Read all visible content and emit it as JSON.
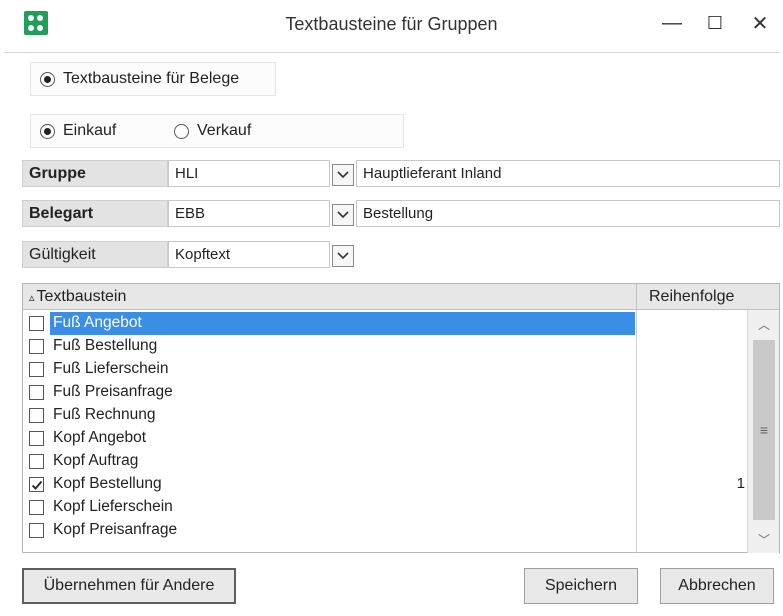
{
  "window": {
    "title": "Textbausteine für Gruppen",
    "controls": {
      "minimize": "—",
      "maximize": "☐",
      "close": "✕"
    }
  },
  "scope": {
    "label": "Textbausteine für Belege",
    "selected": true
  },
  "direction": {
    "einkauf": {
      "label": "Einkauf",
      "selected": true
    },
    "verkauf": {
      "label": "Verkauf",
      "selected": false
    }
  },
  "form": {
    "gruppe": {
      "label": "Gruppe",
      "code": "HLI",
      "description": "Hauptlieferant Inland"
    },
    "belegart": {
      "label": "Belegart",
      "code": "EBB",
      "description": "Bestellung"
    },
    "gueltigkeit": {
      "label": "Gültigkeit",
      "value": "Kopftext"
    }
  },
  "list": {
    "columns": {
      "textbaustein": "Textbaustein",
      "reihenfolge": "Reihenfolge"
    },
    "sort_indicator": "▵",
    "rows": [
      {
        "label": "Fuß Angebot",
        "checked": false,
        "order": "",
        "selected": true
      },
      {
        "label": "Fuß Bestellung",
        "checked": false,
        "order": ""
      },
      {
        "label": "Fuß Lieferschein",
        "checked": false,
        "order": ""
      },
      {
        "label": "Fuß Preisanfrage",
        "checked": false,
        "order": ""
      },
      {
        "label": "Fuß Rechnung",
        "checked": false,
        "order": ""
      },
      {
        "label": "Kopf Angebot",
        "checked": false,
        "order": ""
      },
      {
        "label": "Kopf Auftrag",
        "checked": false,
        "order": ""
      },
      {
        "label": "Kopf Bestellung",
        "checked": true,
        "order": "1"
      },
      {
        "label": "Kopf Lieferschein",
        "checked": false,
        "order": ""
      },
      {
        "label": "Kopf Preisanfrage",
        "checked": false,
        "order": ""
      }
    ]
  },
  "buttons": {
    "uebernehmen": "Übernehmen für Andere",
    "speichern": "Speichern",
    "abbrechen": "Abbrechen"
  },
  "colors": {
    "selection": "#3a8ee6",
    "app_icon": "#1f9f57"
  }
}
